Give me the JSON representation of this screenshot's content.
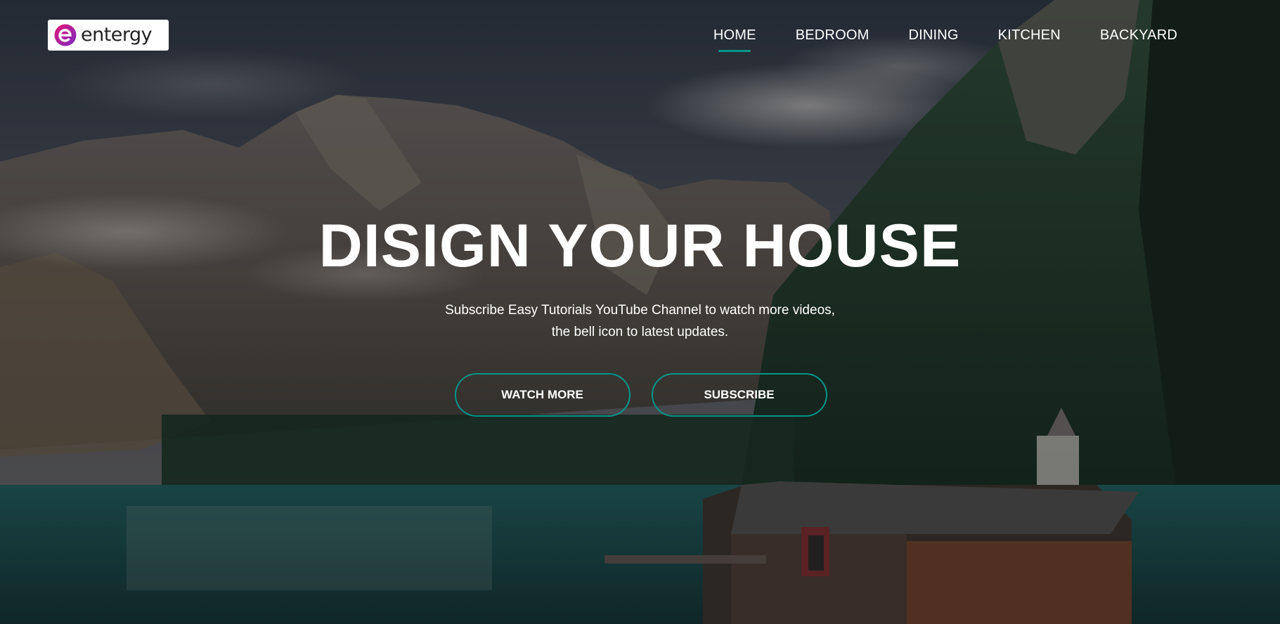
{
  "brand": {
    "logo_text": "entergy",
    "logo_mark": "entergy-e-logo"
  },
  "nav": {
    "items": [
      {
        "label": "HOME",
        "active": true
      },
      {
        "label": "BEDROOM",
        "active": false
      },
      {
        "label": "DINING",
        "active": false
      },
      {
        "label": "KITCHEN",
        "active": false
      },
      {
        "label": "BACKYARD",
        "active": false
      }
    ]
  },
  "hero": {
    "title": "DISIGN YOUR HOUSE",
    "subtitle_line1": "Subscribe Easy Tutorials YouTube Channel to watch more videos,",
    "subtitle_line2": "the bell icon to latest updates.",
    "buttons": [
      {
        "label": "WATCH MORE"
      },
      {
        "label": "SUBSCRIBE"
      }
    ]
  },
  "colors": {
    "accent": "#009688",
    "text": "#ffffff",
    "logo_gradient_start": "#e3176f",
    "logo_gradient_end": "#7a2cc9"
  },
  "background": {
    "scene": "mountain lake with forest and wooden boathouse"
  }
}
